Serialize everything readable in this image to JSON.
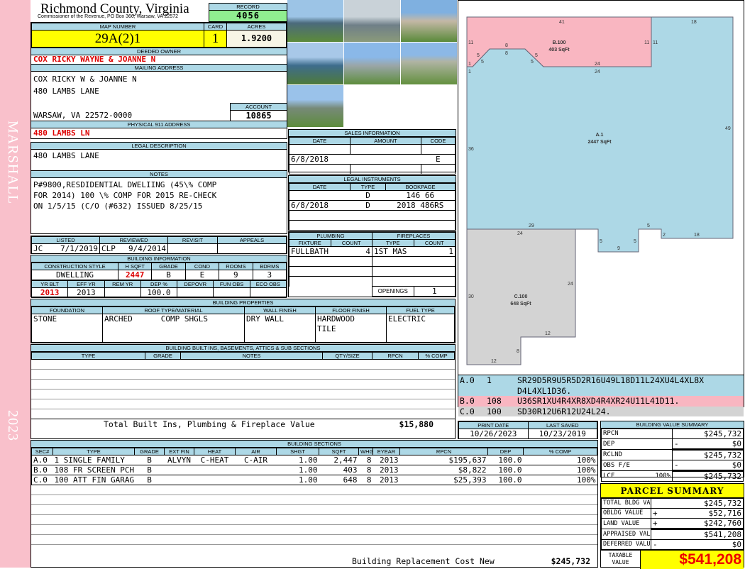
{
  "sidebar": {
    "name": "MARSHALL",
    "year": "2023"
  },
  "header": {
    "title": "Richmond County, Virginia",
    "subtitle": "Commissioner of the Revenue, PO Box 366, Warsaw, VA 22572",
    "record_label": "RECORD",
    "record": "4056"
  },
  "parcel": {
    "map_label": "MAP NUMBER",
    "map": "29A(2)1",
    "card_label": "CARD",
    "card": "1",
    "acres_label": "ACRES",
    "acres": "1.9200"
  },
  "owner": {
    "label": "DEEDED OWNER",
    "value": "COX RICKY WAYNE & JOANNE N"
  },
  "mailing": {
    "label": "MAILING ADDRESS",
    "lines": [
      "COX RICKY W & JOANNE N",
      "480 LAMBS LANE",
      "",
      "WARSAW, VA 22572-0000"
    ],
    "account_label": "ACCOUNT",
    "account": "10865"
  },
  "physical": {
    "label": "PHYSICAL 911 ADDRESS",
    "value": "480 LAMBS LN"
  },
  "legal": {
    "label": "LEGAL DESCRIPTION",
    "value": "480 LAMBS LANE"
  },
  "notes": {
    "label": "NOTES",
    "lines": [
      "P#9800,RESDIDENTIAL DWELIING (45\\% COMP",
      "FOR 2014) 100 \\% COMP FOR 2015 RE-CHECK",
      "ON 1/5/15 (C/O (#632) ISSUED 8/25/15"
    ]
  },
  "review": {
    "headers": [
      "LISTED",
      "REVIEWED",
      "REVISIT",
      "APPEALS"
    ],
    "listed_by": "JC",
    "listed_date": "7/1/2019",
    "reviewed_by": "CLP",
    "reviewed_date": "9/4/2014"
  },
  "building_info": {
    "label": "BUILDING INFORMATION",
    "headers1": [
      "CONSTRUCTION STYLE",
      "H SQFT",
      "GRADE",
      "COND",
      "ROOMS",
      "BDRMS"
    ],
    "values1": [
      "DWELLING",
      "2447",
      "B",
      "E",
      "9",
      "3"
    ],
    "headers2": [
      "YR BLT",
      "EFF YR",
      "REM YR",
      "DEP %",
      "DEPOVR",
      "FUN OBS",
      "ECO OBS"
    ],
    "values2": [
      "2013",
      "2013",
      "",
      "100.0",
      "",
      "",
      ""
    ]
  },
  "properties": {
    "label": "BUILDING PROPERTIES",
    "headers": [
      "FOUNDATION",
      "ROOF TYPE/MATERIAL",
      "WALL FINISH",
      "FLOOR FINISH",
      "FUEL TYPE"
    ],
    "foundation": "STONE",
    "roof_type": "ARCHED",
    "roof_material": "COMP SHGLS",
    "wall": "DRY WALL",
    "floor": [
      "HARDWOOD",
      "TILE"
    ],
    "fuel": "ELECTRIC"
  },
  "builtins": {
    "label": "BUILDING BUILT INS, BASEMENTS, ATTICS & SUB SECTIONS",
    "headers": [
      "TYPE",
      "GRADE",
      "NOTES",
      "QTY/SIZE",
      "RPCN",
      "% COMP"
    ],
    "total_label": "Total Built Ins, Plumbing & Fireplace Value",
    "total": "$15,880"
  },
  "sales": {
    "label": "SALES INFORMATION",
    "headers": [
      "DATE",
      "AMOUNT",
      "CODE"
    ],
    "rows": [
      [
        "",
        "",
        ""
      ],
      [
        "6/8/2018",
        "",
        "E"
      ],
      [
        "",
        "",
        ""
      ]
    ]
  },
  "instruments": {
    "label": "LEGAL INSTRUMENTS",
    "headers": [
      "DATE",
      "TYPE",
      "BOOKPAGE"
    ],
    "rows": [
      [
        "",
        "D",
        "146 66"
      ],
      [
        "6/8/2018",
        "D",
        "2018 486RS"
      ],
      [
        "",
        "",
        ""
      ],
      [
        "",
        "",
        ""
      ]
    ]
  },
  "plumbing": {
    "label": "PLUMBING",
    "headers": [
      "FIXTURE",
      "COUNT"
    ],
    "rows": [
      [
        "FULLBATH",
        "4"
      ]
    ]
  },
  "fireplaces": {
    "label": "FIREPLACES",
    "headers": [
      "TYPE",
      "COUNT"
    ],
    "rows": [
      [
        "1ST MAS",
        "1"
      ]
    ],
    "openings_label": "OPENINGS",
    "openings": "1"
  },
  "sketch": {
    "areas": [
      {
        "code": "A.1",
        "sqft": "2447 SqFt"
      },
      {
        "code": "B.100",
        "sqft": "403 SqFt"
      },
      {
        "code": "C.100",
        "sqft": "648 SqFt"
      }
    ],
    "dims": [
      "41",
      "18",
      "11",
      "11",
      "11",
      "8",
      "8",
      "5",
      "5",
      "5",
      "5",
      "1",
      "1",
      "24",
      "24",
      "49",
      "36",
      "29",
      "24",
      "5",
      "9",
      "5",
      "5",
      "2",
      "18",
      "24",
      "30",
      "12",
      "8",
      "12"
    ]
  },
  "sketch_codes": [
    {
      "sec": "A.0",
      "code": "1",
      "vectors": "SR29D5R9U5R5D2R16U49L18D11L24XU4L4XL8X D4L4XL1D36.",
      "color": "#add8e6"
    },
    {
      "sec": "B.0",
      "code": "108",
      "vectors": "U36SR1XU4R4XR8XD4R4XR24U11L41D11.",
      "color": "#f9b6c1"
    },
    {
      "sec": "C.0",
      "code": "100",
      "vectors": "SD30R12U6R12U24L24.",
      "color": "#d3d3d3"
    }
  ],
  "dates": {
    "print_label": "PRINT DATE",
    "print": "10/26/2023",
    "saved_label": "LAST SAVED",
    "saved": "10/23/2019"
  },
  "sections": {
    "label": "BUILDING SECTIONS",
    "headers": [
      "SEC#",
      "TYPE",
      "GRADE",
      "EXT FIN",
      "HEAT",
      "AIR",
      "SHGT",
      "SQFT",
      "WHGT",
      "EYEAR",
      "RPCN",
      "DEP",
      "% COMP"
    ],
    "rows": [
      [
        "A.0",
        "1 SINGLE FAMILY",
        "B",
        "ALVYN",
        "C-HEAT",
        "C-AIR",
        "1.00",
        "2,447",
        "8",
        "2013",
        "$195,637",
        "100.0",
        "100%"
      ],
      [
        "B.0",
        "108 FR SCREEN PCH",
        "B",
        "",
        "",
        "",
        "1.00",
        "403",
        "8",
        "2013",
        "$8,822",
        "100.0",
        "100%"
      ],
      [
        "C.0",
        "100 ATT FIN GARAGE",
        "B",
        "",
        "",
        "",
        "1.00",
        "648",
        "8",
        "2013",
        "$25,393",
        "100.0",
        "100%"
      ]
    ],
    "total_label": "Building Replacement Cost New",
    "total": "$245,732"
  },
  "value_summary": {
    "label": "BUILDING VALUE SUMMARY",
    "rows": [
      {
        "label": "RPCN",
        "op": "",
        "pct": "",
        "value": "$245,732"
      },
      {
        "label": "DEP",
        "op": "-",
        "pct": "",
        "value": "$0"
      },
      {
        "label": "RCLND",
        "op": "",
        "pct": "",
        "value": "$245,732"
      },
      {
        "label": "OBS F/E",
        "op": "-",
        "pct": "",
        "value": "$0"
      },
      {
        "label": "LCF",
        "op": "",
        "pct": "100%",
        "value": "$245,732"
      }
    ]
  },
  "parcel_summary": {
    "title": "PARCEL SUMMARY",
    "rows": [
      {
        "label": "TOTAL BLDG VALUE",
        "op": "",
        "value": "$245,732"
      },
      {
        "label": "OBLDG VALUE",
        "op": "+",
        "value": "$52,716"
      },
      {
        "label": "LAND VALUE",
        "op": "+",
        "value": "$242,760"
      },
      {
        "label": "APPRAISED VALUE",
        "op": "",
        "value": "$541,208"
      },
      {
        "label": "DEFERRED VALUE",
        "op": "-",
        "value": "$0"
      }
    ],
    "taxable_label": "TAXABLE VALUE",
    "taxable": "$541,208"
  },
  "colors": {
    "header": "#add8e6",
    "highlight": "#ffff00",
    "record": "#90ee90",
    "sidebar": "#f9c0cb",
    "red": "#dd0000"
  }
}
